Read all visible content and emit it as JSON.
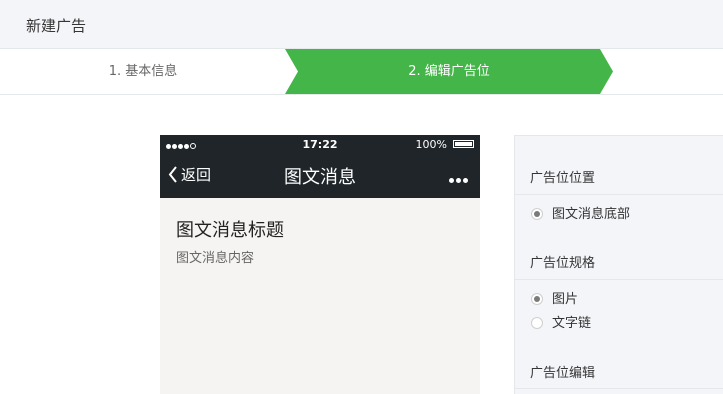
{
  "header": {
    "title": "新建广告"
  },
  "steps": [
    {
      "label": "1. 基本信息",
      "active": false
    },
    {
      "label": "2. 编辑广告位",
      "active": true
    }
  ],
  "colors": {
    "accent": "#44b549",
    "phone_bar": "#1f2529",
    "header_bg": "#f4f5f9"
  },
  "phone": {
    "status": {
      "time": "17:22",
      "battery": "100%",
      "signal_icon": "signal-dots-icon",
      "battery_icon": "battery-icon"
    },
    "nav": {
      "back_label": "返回",
      "title": "图文消息",
      "more_icon": "more-dots-icon",
      "back_icon": "chevron-left-icon"
    },
    "message": {
      "title": "图文消息标题",
      "content": "图文消息内容"
    }
  },
  "panel": {
    "position": {
      "title": "广告位位置",
      "options": [
        {
          "label": "图文消息底部",
          "checked": true
        }
      ]
    },
    "spec": {
      "title": "广告位规格",
      "options": [
        {
          "label": "图片",
          "checked": true
        },
        {
          "label": "文字链",
          "checked": false
        }
      ]
    },
    "edit": {
      "title": "广告位编辑"
    }
  }
}
